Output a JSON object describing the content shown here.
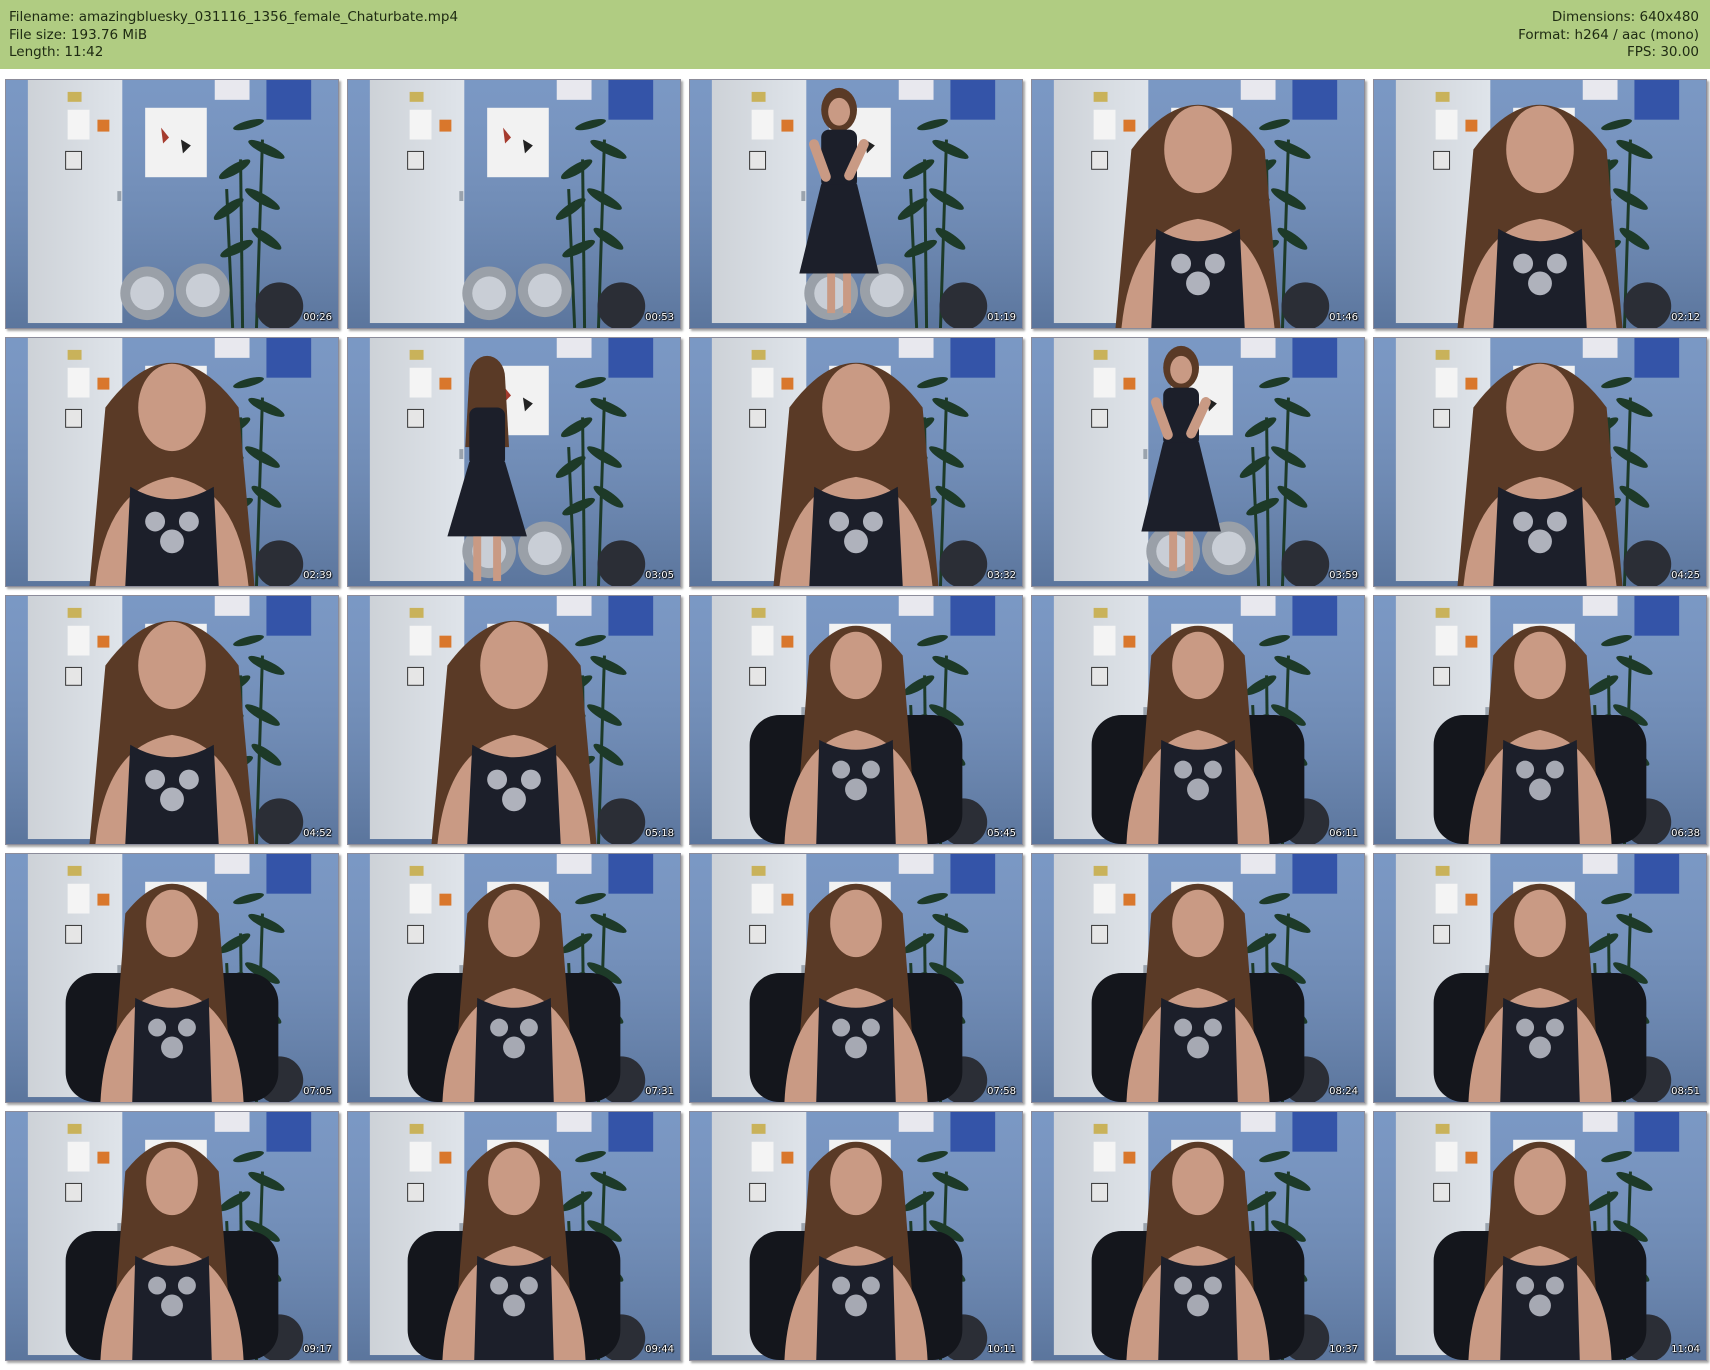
{
  "header": {
    "filename": "Filename: amazingbluesky_031116_1356_female_Chaturbate.mp4",
    "filesize": "File size: 193.76 MiB",
    "length": "Length: 11:42",
    "dimensions": "Dimensions: 640x480",
    "format": "Format: h264 / aac (mono)",
    "fps": "FPS: 30.00"
  },
  "colors": {
    "header_bg": "#b0cc82",
    "wall": "#6f8fbf",
    "door": "#dfe4ea",
    "dress": "#1c1f2a",
    "hair": "#5a3a26",
    "skin": "#c99a84",
    "plant": "#1d3a28"
  },
  "thumbnails": [
    {
      "time": "00:26",
      "scene": "empty"
    },
    {
      "time": "00:53",
      "scene": "empty"
    },
    {
      "time": "01:19",
      "scene": "standing"
    },
    {
      "time": "01:46",
      "scene": "close"
    },
    {
      "time": "02:12",
      "scene": "close"
    },
    {
      "time": "02:39",
      "scene": "close"
    },
    {
      "time": "03:05",
      "scene": "back"
    },
    {
      "time": "03:32",
      "scene": "close"
    },
    {
      "time": "03:59",
      "scene": "standing"
    },
    {
      "time": "04:25",
      "scene": "close"
    },
    {
      "time": "04:52",
      "scene": "close"
    },
    {
      "time": "05:18",
      "scene": "close"
    },
    {
      "time": "05:45",
      "scene": "seated"
    },
    {
      "time": "06:11",
      "scene": "seated"
    },
    {
      "time": "06:38",
      "scene": "seated"
    },
    {
      "time": "07:05",
      "scene": "seated"
    },
    {
      "time": "07:31",
      "scene": "seated"
    },
    {
      "time": "07:58",
      "scene": "seated"
    },
    {
      "time": "08:24",
      "scene": "seated"
    },
    {
      "time": "08:51",
      "scene": "seated"
    },
    {
      "time": "09:17",
      "scene": "seated"
    },
    {
      "time": "09:44",
      "scene": "seated"
    },
    {
      "time": "10:11",
      "scene": "seated"
    },
    {
      "time": "10:37",
      "scene": "seated"
    },
    {
      "time": "11:04",
      "scene": "seated"
    }
  ]
}
